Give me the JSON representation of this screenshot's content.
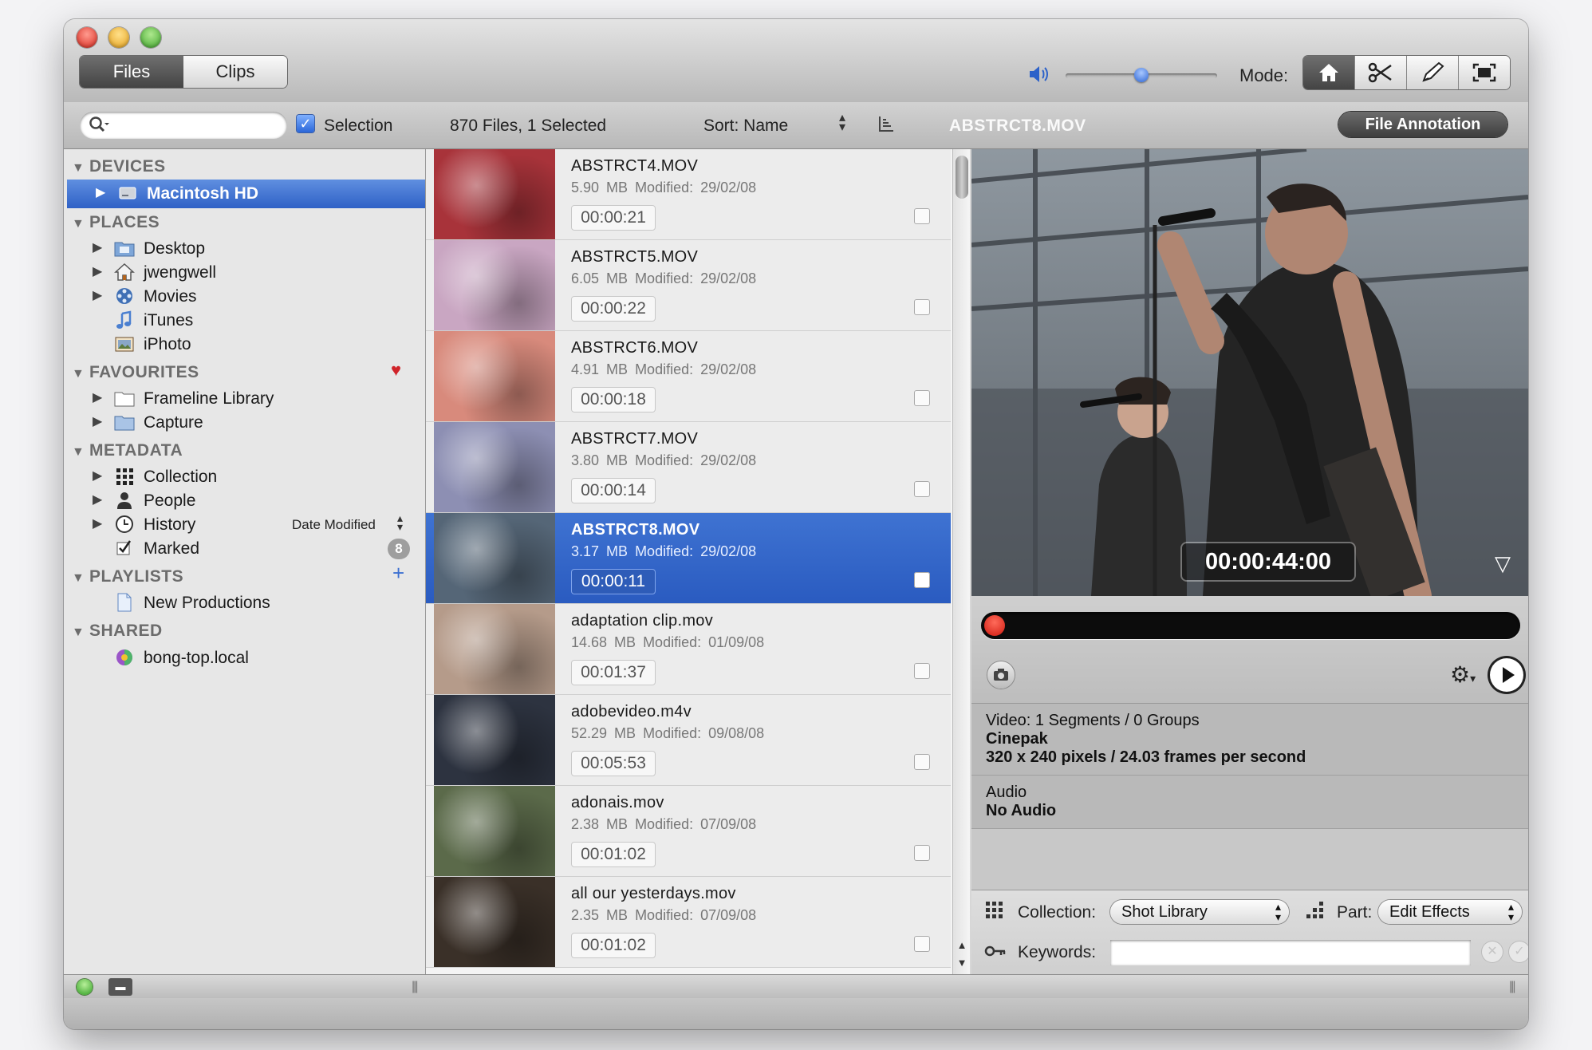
{
  "toolbar": {
    "tabs": [
      "Files",
      "Clips"
    ],
    "active_tab": "Files",
    "volume_level": 0.5,
    "mode_label": "Mode:",
    "mode_icons": [
      "home-icon",
      "scissors-icon",
      "pencil-icon",
      "fullscreen-icon"
    ]
  },
  "subbar": {
    "search_value": "",
    "selection_label": "Selection",
    "selection_checked": true,
    "files_count": "870 Files, 1 Selected",
    "sort_label": "Sort: Name",
    "preview_title": "ABSTRCT8.MOV",
    "annotation_button": "File Annotation"
  },
  "sidebar": {
    "sections": {
      "devices": "DEVICES",
      "places": "PLACES",
      "favourites": "FAVOURITES",
      "metadata": "METADATA",
      "playlists": "PLAYLISTS",
      "shared": "SHARED"
    },
    "devices": [
      {
        "label": "Macintosh HD"
      }
    ],
    "places": [
      {
        "label": "Desktop"
      },
      {
        "label": "jwengwell"
      },
      {
        "label": "Movies"
      },
      {
        "label": "iTunes"
      },
      {
        "label": "iPhoto"
      }
    ],
    "favourites": [
      {
        "label": "Frameline Library"
      },
      {
        "label": "Capture"
      }
    ],
    "metadata": [
      {
        "label": "Collection"
      },
      {
        "label": "People"
      },
      {
        "label": "History"
      },
      {
        "label": "Marked"
      }
    ],
    "history_sort": "Date Modified",
    "marked_count": "8",
    "playlists": [
      {
        "label": "New Productions"
      }
    ],
    "shared": [
      {
        "label": "bong-top.local"
      }
    ]
  },
  "files": [
    {
      "name": "ABSTRCT4.MOV",
      "size": "5.90 MB",
      "modified": "Modified: 29/02/08",
      "duration": "00:00:21",
      "thumb_color": "#a8333a"
    },
    {
      "name": "ABSTRCT5.MOV",
      "size": "6.05 MB",
      "modified": "Modified: 29/02/08",
      "duration": "00:00:22",
      "thumb_color": "#c9a6c2"
    },
    {
      "name": "ABSTRCT6.MOV",
      "size": "4.91 MB",
      "modified": "Modified: 29/02/08",
      "duration": "00:00:18",
      "thumb_color": "#d88a7c"
    },
    {
      "name": "ABSTRCT7.MOV",
      "size": "3.80 MB",
      "modified": "Modified: 29/02/08",
      "duration": "00:00:14",
      "thumb_color": "#8d8fb3"
    },
    {
      "name": "ABSTRCT8.MOV",
      "size": "3.17 MB",
      "modified": "Modified: 29/02/08",
      "duration": "00:00:11",
      "thumb_color": "#556677",
      "selected": true
    },
    {
      "name": "adaptation clip.mov",
      "size": "14.68 MB",
      "modified": "Modified: 01/09/08",
      "duration": "00:01:37",
      "thumb_color": "#b59b8a"
    },
    {
      "name": "adobevideo.m4v",
      "size": "52.29 MB",
      "modified": "Modified: 09/08/08",
      "duration": "00:05:53",
      "thumb_color": "#2d3340"
    },
    {
      "name": "adonais.mov",
      "size": "2.38 MB",
      "modified": "Modified: 07/09/08",
      "duration": "00:01:02",
      "thumb_color": "#5b6a4a"
    },
    {
      "name": "all our yesterdays.mov",
      "size": "2.35 MB",
      "modified": "Modified: 07/09/08",
      "duration": "00:01:02",
      "thumb_color": "#3a3028"
    }
  ],
  "preview": {
    "timecode": "00:00:44:00",
    "video_line": "Video:  1 Segments / 0 Groups",
    "codec": "Cinepak",
    "dimensions": "320 x 240 pixels / 24.03 frames per second",
    "audio_label": "Audio",
    "audio_value": "No Audio",
    "collection_label": "Collection:",
    "collection_value": "Shot Library",
    "part_label": "Part:",
    "part_value": "Edit Effects",
    "keywords_label": "Keywords:",
    "keywords_value": ""
  },
  "colors": {
    "selection_blue": "#2f61c6",
    "record_red": "#cf1a10",
    "favourite_heart": "#d0242a"
  }
}
